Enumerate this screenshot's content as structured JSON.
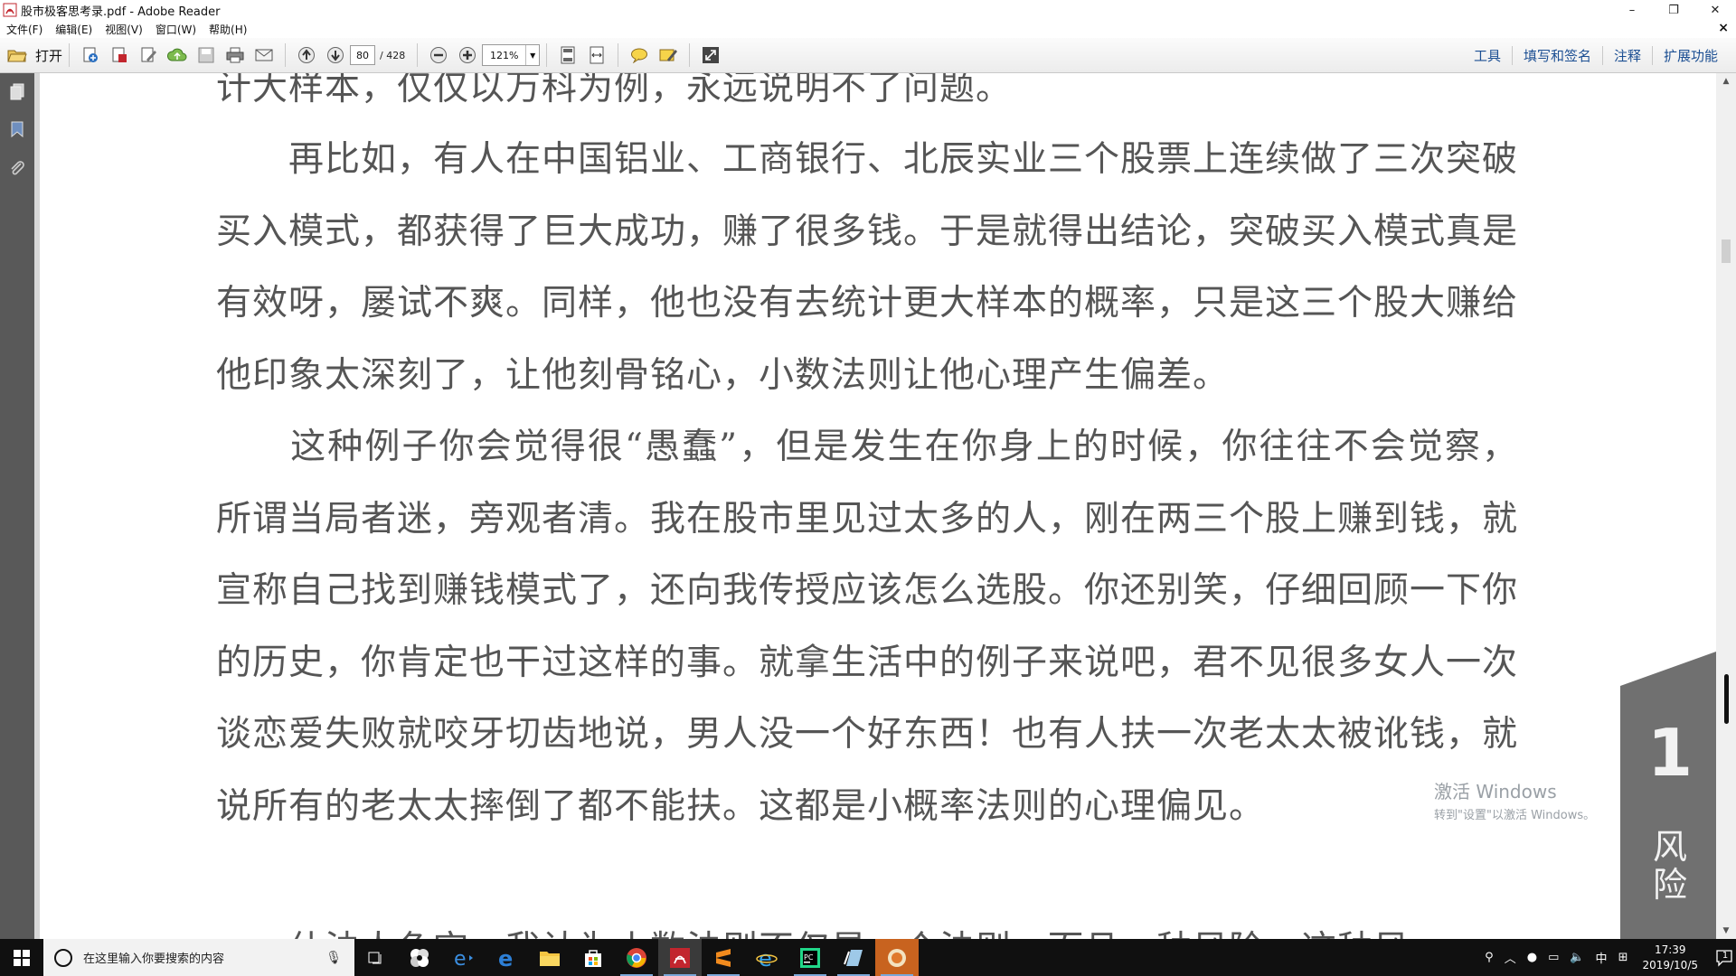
{
  "window": {
    "title": "股市极客思考录.pdf - Adobe Reader",
    "minimize": "–",
    "restore": "❐",
    "close": "✕",
    "close_document": "×"
  },
  "menubar": [
    "文件(F)",
    "编辑(E)",
    "视图(V)",
    "窗口(W)",
    "帮助(H)"
  ],
  "toolbar": {
    "open_label": "打开",
    "page_current": "80",
    "page_total": "/ 428",
    "zoom": "121%",
    "right_links": [
      "工具",
      "填写和签名",
      "注释",
      "扩展功能"
    ]
  },
  "document": {
    "paragraphs": [
      "计大样本，仅仅以万科为例，永远说明不了问题。",
      "　　再比如，有人在中国铝业、工商银行、北辰实业三个股票上连续做了三次突破买入模式，都获得了巨大成功，赚了很多钱。于是就得出结论，突破买入模式真是有效呀，屡试不爽。同样，他也没有去统计更大样本的概率，只是这三个股大赚给他印象太深刻了，让他刻骨铭心，小数法则让他心理产生偏差。",
      "　　这种例子你会觉得很“愚蠢”，但是发生在你身上的时候，你往往不会觉察，所谓当局者迷，旁观者清。我在股市里见过太多的人，刚在两三个股上赚到钱，就宣称自己找到赚钱模式了，还向我传授应该怎么选股。你还别笑，仔细回顾一下你的历史，你肯定也干过这样的事。就拿生活中的例子来说吧，君不见很多女人一次谈恋爱失败就咬牙切齿地说，男人没一个好东西！也有人扶一次老太太被讹钱，就说所有的老太太摔倒了都不能扶。这都是小概率法则的心理偏见。",
      "　　什法人色空，我认为小数法则不仅是一个法则，而且一种风险，这种风"
    ],
    "chapter_tab_number": "1",
    "chapter_tab_text": "风险"
  },
  "watermark": {
    "line1": "激活 Windows",
    "line2": "转到\"设置\"以激活 Windows。"
  },
  "taskbar": {
    "search_placeholder": "在这里输入你要搜索的内容",
    "time": "17:39",
    "date": "2019/10/5",
    "ime": "中",
    "notification_count": "1"
  },
  "colors": {
    "link_blue": "#1c4f93",
    "left_pane": "#595959",
    "taskbar": "#101010",
    "chapter_tab": "#707070"
  }
}
